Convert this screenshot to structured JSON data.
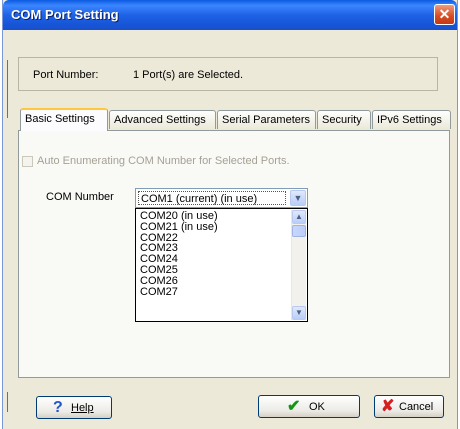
{
  "window": {
    "title": "COM Port Setting",
    "close_glyph": "✕"
  },
  "port_info": {
    "label": "Port Number:",
    "value": "1 Port(s) are Selected."
  },
  "tabs": [
    {
      "label": "Basic Settings",
      "active": true
    },
    {
      "label": "Advanced Settings",
      "active": false
    },
    {
      "label": "Serial Parameters",
      "active": false
    },
    {
      "label": "Security",
      "active": false
    },
    {
      "label": "IPv6 Settings",
      "active": false
    }
  ],
  "basic": {
    "auto_label": "Auto Enumerating COM Number for Selected Ports.",
    "auto_checked": false,
    "auto_enabled": false,
    "com_label": "COM Number",
    "com_value": "COM1 (current) (in use)",
    "com_options": [
      "COM20 (in use)",
      "COM21 (in use)",
      "COM22",
      "COM23",
      "COM24",
      "COM25",
      "COM26",
      "COM27"
    ]
  },
  "buttons": {
    "help": {
      "label": "Help",
      "icon": "question-icon",
      "glyph": "?"
    },
    "ok": {
      "label": "OK",
      "icon": "checkmark-icon",
      "glyph": "✔"
    },
    "cancel": {
      "label": "Cancel",
      "icon": "x-mark-icon",
      "glyph": "✘"
    }
  },
  "icons": {
    "combo_arrow": "▼",
    "scroll_up": "▲",
    "scroll_down": "▼"
  },
  "colors": {
    "titlebar": "#1f62e6",
    "dialog_bg": "#ece9d8",
    "tab_highlight": "#ffc83c",
    "close": "#d84a22"
  }
}
